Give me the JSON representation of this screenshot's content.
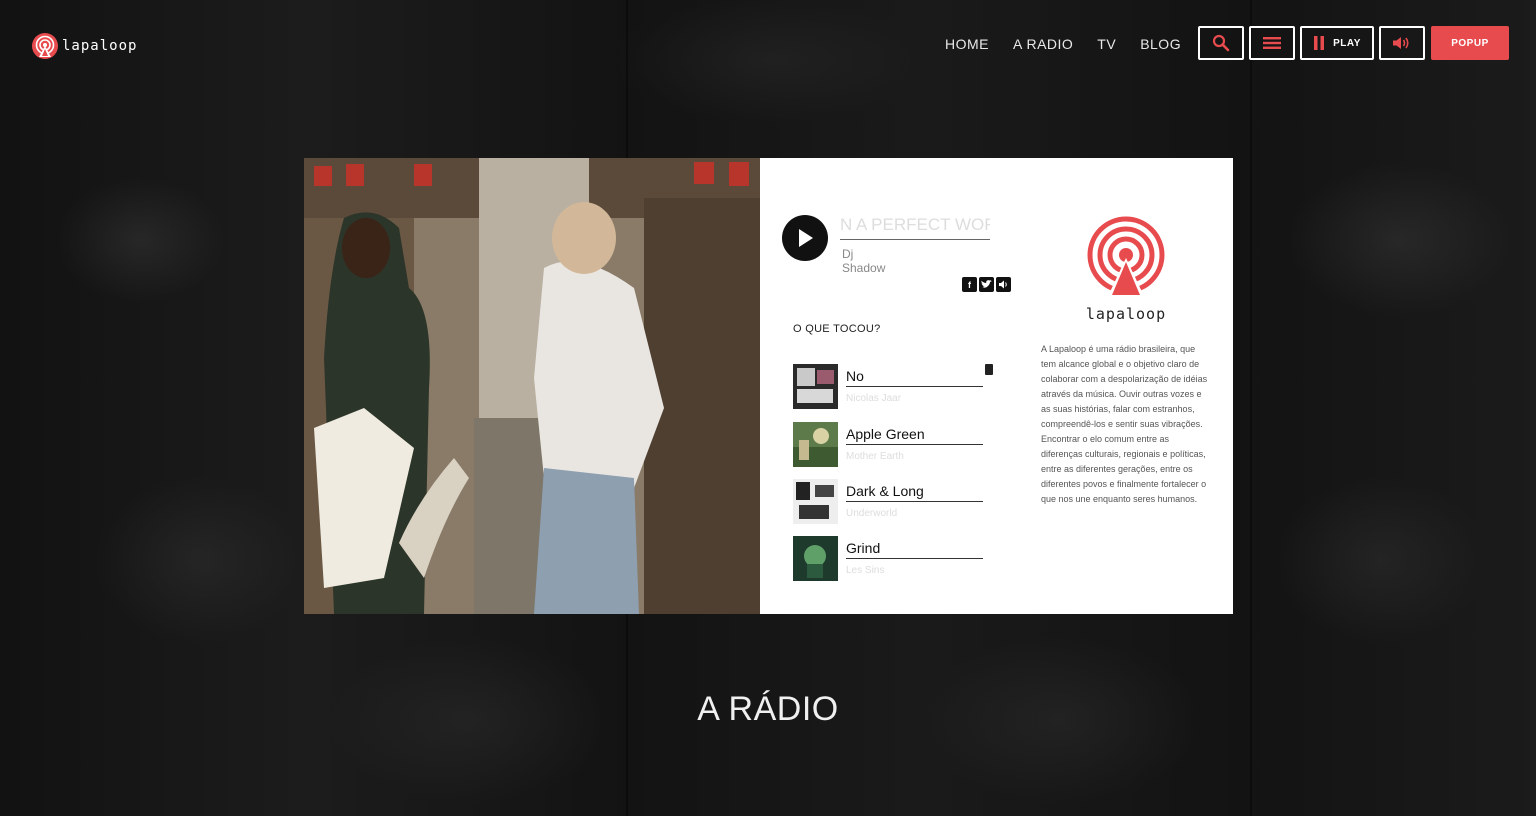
{
  "header": {
    "logo_text": "lapaloop",
    "nav": [
      "HOME",
      "A RADIO",
      "TV",
      "BLOG"
    ],
    "play_label": "PLAY",
    "popup_label": "POPUP",
    "accent": "#e84b4e"
  },
  "player": {
    "now_playing_title": "N A PERFECT WORL",
    "now_playing_artist": "Dj Shadow",
    "share_icons": [
      "facebook-icon",
      "twitter-icon",
      "speaker-icon"
    ]
  },
  "recent": {
    "heading": "O QUE TOCOU?",
    "tracks": [
      {
        "title": "No",
        "artist": "Nicolas Jaar"
      },
      {
        "title": "Apple Green",
        "artist": "Mother Earth"
      },
      {
        "title": "Dark & Long",
        "artist": "Underworld"
      },
      {
        "title": "Grind",
        "artist": "Les Sins"
      }
    ]
  },
  "brand": {
    "name": "lapaloop",
    "about": "A Lapaloop é uma rádio brasileira, que tem alcance global e o objetivo claro de colaborar com a despolarização de idéias através da música. Ouvir outras vozes e as suas histórias, falar com estranhos, compreendê-los e sentir suas vibrações. Encontrar o elo comum entre as diferenças culturais, regionais e políticas, entre as diferentes gerações, entre os diferentes povos e finalmente fortalecer o que nos une enquanto seres humanos."
  },
  "section": {
    "title": "A RÁDIO"
  }
}
